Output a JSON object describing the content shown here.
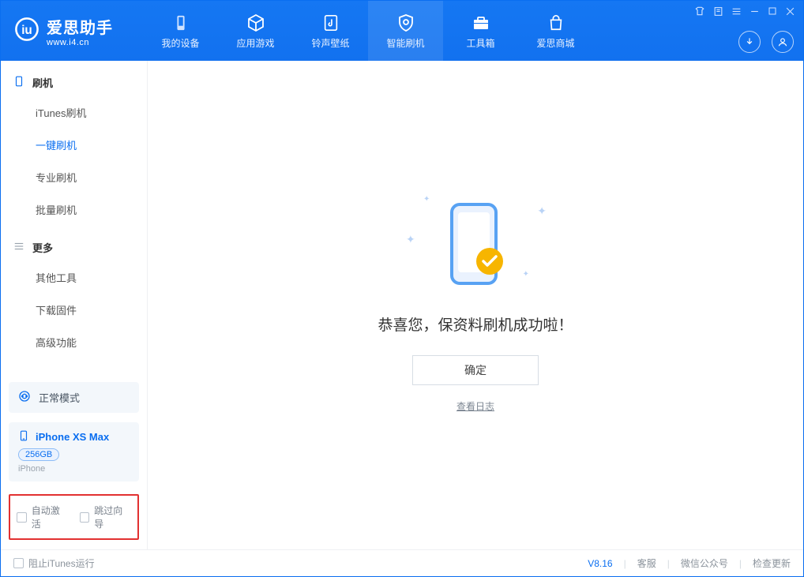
{
  "app": {
    "name_cn": "爱思助手",
    "url": "www.i4.cn"
  },
  "topnav": {
    "items": [
      {
        "label": "我的设备"
      },
      {
        "label": "应用游戏"
      },
      {
        "label": "铃声壁纸"
      },
      {
        "label": "智能刷机"
      },
      {
        "label": "工具箱"
      },
      {
        "label": "爱思商城"
      }
    ]
  },
  "sidebar": {
    "section1_title": "刷机",
    "section1_items": [
      {
        "label": "iTunes刷机"
      },
      {
        "label": "一键刷机"
      },
      {
        "label": "专业刷机"
      },
      {
        "label": "批量刷机"
      }
    ],
    "section2_title": "更多",
    "section2_items": [
      {
        "label": "其他工具"
      },
      {
        "label": "下载固件"
      },
      {
        "label": "高级功能"
      }
    ],
    "mode_label": "正常模式",
    "device": {
      "name": "iPhone XS Max",
      "storage": "256GB",
      "type": "iPhone"
    },
    "opt_auto_activate": "自动激活",
    "opt_skip_guide": "跳过向导"
  },
  "main": {
    "message": "恭喜您，保资料刷机成功啦！",
    "ok_label": "确定",
    "log_link": "查看日志"
  },
  "statusbar": {
    "block_itunes": "阻止iTunes运行",
    "version": "V8.16",
    "support": "客服",
    "wechat": "微信公众号",
    "update": "检查更新"
  },
  "colors": {
    "accent": "#0a6ef0"
  }
}
